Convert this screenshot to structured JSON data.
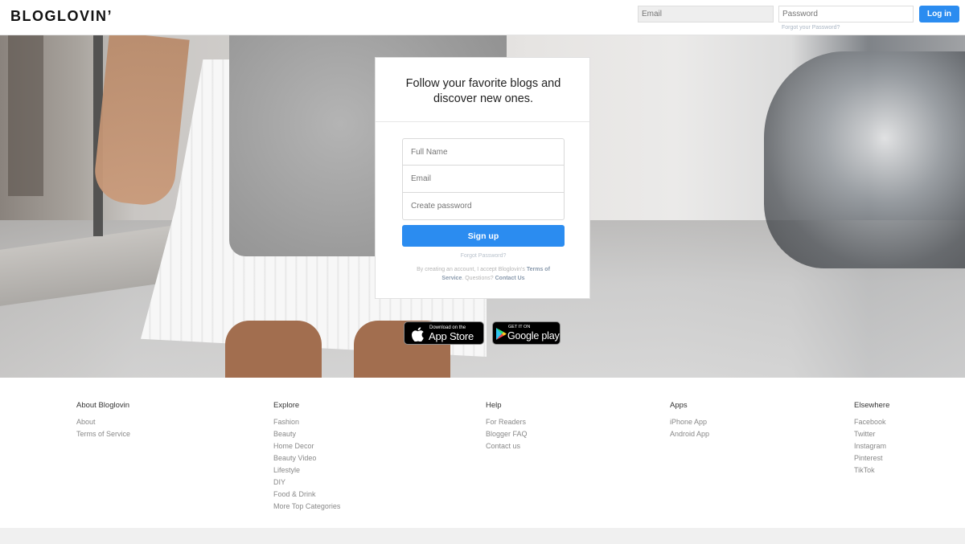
{
  "header": {
    "logo": "BLOGLOVIN’",
    "email_placeholder": "Email",
    "password_placeholder": "Password",
    "forgot_password": "Forgot your Password?",
    "login_label": "Log in"
  },
  "signup": {
    "title": "Follow your favorite blogs and discover new ones.",
    "full_name_placeholder": "Full Name",
    "email_placeholder": "Email",
    "password_placeholder": "Create password",
    "signup_label": "Sign up",
    "forgot_password": "Forgot Password?",
    "terms_prefix": "By creating an account, I accept Bloglovin's",
    "terms_link": "Terms of Service",
    "terms_mid": ". Questions?",
    "contact_link": "Contact Us"
  },
  "badges": {
    "apple_small": "Download on the",
    "apple_big": "App Store",
    "google_small": "GET IT ON",
    "google_big": "Google play"
  },
  "footer": {
    "columns": [
      {
        "title": "About Bloglovin",
        "links": [
          "About",
          "Terms of Service"
        ]
      },
      {
        "title": "Explore",
        "links": [
          "Fashion",
          "Beauty",
          "Home Decor",
          "Beauty Video",
          "Lifestyle",
          "DIY",
          "Food & Drink",
          "More Top Categories"
        ]
      },
      {
        "title": "Help",
        "links": [
          "For Readers",
          "Blogger FAQ",
          "Contact us"
        ]
      },
      {
        "title": "Apps",
        "links": [
          "iPhone App",
          "Android App"
        ]
      },
      {
        "title": "Elsewhere",
        "links": [
          "Facebook",
          "Twitter",
          "Instagram",
          "Pinterest",
          "TikTok"
        ]
      }
    ]
  },
  "colors": {
    "accent": "#2b8cf0",
    "footer_text": "#888888"
  }
}
